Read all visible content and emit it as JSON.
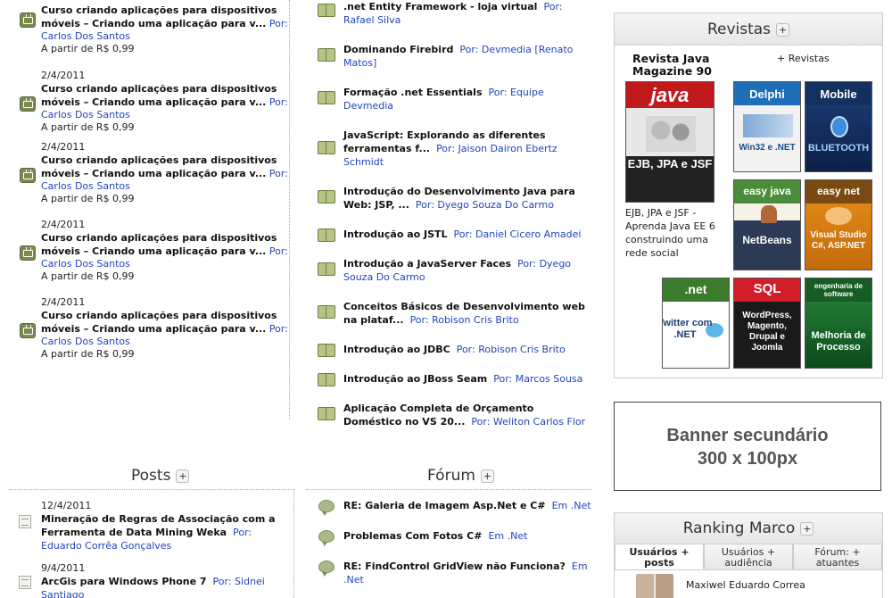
{
  "videos": [
    {
      "date": "",
      "title": "Curso criando aplicações para dispositivos móveis – Criando uma aplicação para v...",
      "by": "Por:",
      "author": "Carlos Dos Santos",
      "price": "A partir de R$ 0,99"
    },
    {
      "date": "2/4/2011",
      "title": "Curso criando aplicações para dispositivos móveis – Criando uma aplicação para v...",
      "by": "Por:",
      "author": "Carlos Dos Santos",
      "price": "A partir de R$ 0,99"
    },
    {
      "date": "2/4/2011",
      "title": "Curso criando aplicações para dispositivos móveis – Criando uma aplicação para v...",
      "by": "Por:",
      "author": "Carlos Dos Santos",
      "price": "A partir de R$ 0,99"
    },
    {
      "date": "2/4/2011",
      "title": "Curso criando aplicações para dispositivos móveis – Criando uma aplicação para v...",
      "by": "Por:",
      "author": "Carlos Dos Santos",
      "price": "A partir de R$ 0,99"
    },
    {
      "date": "2/4/2011",
      "title": "Curso criando aplicações para dispositivos móveis – Criando uma aplicação para v...",
      "by": "Por:",
      "author": "Carlos Dos Santos",
      "price": "A partir de R$ 0,99"
    }
  ],
  "articles": [
    {
      "title": ".net Entity Framework - loja virtual",
      "author": "Por: Rafael Silva"
    },
    {
      "title": "Dominando Firebird",
      "author": "Por: Devmedia [Renato Matos]"
    },
    {
      "title": "Formação .net Essentials",
      "author": "Por: Equipe Devmedia"
    },
    {
      "title": "JavaScript: Explorando as diferentes ferramentas f...",
      "author": "Por: Jaison Dairon Ebertz Schmidt"
    },
    {
      "title": "Introdução do Desenvolvimento Java para Web: JSP, ...",
      "author": "Por: Dyego Souza Do Carmo"
    },
    {
      "title": "Introdução ao JSTL",
      "author": "Por: Daniel Cicero Amadei"
    },
    {
      "title": "Introdução a JavaServer Faces",
      "author": "Por: Dyego Souza Do Carmo"
    },
    {
      "title": "Conceitos Básicos de Desenvolvimento web na plataf...",
      "author": "Por: Robison Cris Brito"
    },
    {
      "title": "Introdução ao JDBC",
      "author": "Por: Robison Cris Brito"
    },
    {
      "title": "Introdução ao JBoss Seam",
      "author": "Por: Marcos Sousa"
    },
    {
      "title": "Aplicação Completa de Orçamento Doméstico no VS 20...",
      "author": "Por: Weliton Carlos Flor"
    }
  ],
  "revistas": {
    "title": "Revistas",
    "plus": "+",
    "featured_title": "Revista Java Magazine 90",
    "more_label": "+ Revistas",
    "featured_desc": "EJB, JPA e JSF - Aprenda Java EE 6 construindo uma rede social",
    "covers": [
      {
        "brand": "java",
        "headline": "EJB, JPA e JSF"
      },
      {
        "brand": "Delphi",
        "headline": "Win32 e .NET"
      },
      {
        "brand": "Mobile",
        "headline": "BLUETOOTH"
      },
      {
        "brand": "easy java",
        "headline": "NetBeans"
      },
      {
        "brand": "easy net",
        "headline": "Visual Studio C#, ASP.NET"
      },
      {
        "brand": ".net",
        "headline": "Twitter com .NET"
      },
      {
        "brand": "SQL",
        "headline": "WordPress, Magento, Drupal e Joomla"
      },
      {
        "brand": "engenharia de software",
        "headline": "Melhoria de Processo"
      }
    ]
  },
  "banner": {
    "line1": "Banner secundário",
    "line2": "300 x 100px"
  },
  "ranking": {
    "title": "Ranking Marco",
    "plus": "+",
    "tabs": [
      "Usuários + posts",
      "Usuários + audiência",
      "Fórum: + atuantes"
    ],
    "first_name": "Maxiwel Eduardo Correa"
  },
  "posts": {
    "title": "Posts",
    "plus": "+",
    "items": [
      {
        "date": "12/4/2011",
        "title": "Mineração de Regras de Associação com a Ferramenta de Data Mining Weka",
        "author": "Por: Eduardo Corrêa Gonçalves"
      },
      {
        "date": "9/4/2011",
        "title": "ArcGis para Windows Phone 7",
        "author": "Por: Sidnei Santiago"
      }
    ]
  },
  "forum": {
    "title": "Fórum",
    "plus": "+",
    "items": [
      {
        "title": "RE: Galeria de Imagem Asp.Net e C#",
        "area": "Em .Net"
      },
      {
        "title": "Problemas Com Fotos C#",
        "area": "Em .Net"
      },
      {
        "title": "RE: FindControl GridView não Funciona?",
        "area": "Em .Net"
      }
    ]
  },
  "colors": {
    "link": "#2244bb",
    "icon_green": "#7c8a52"
  }
}
